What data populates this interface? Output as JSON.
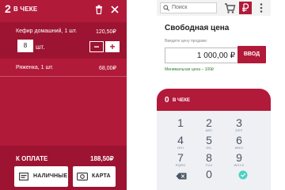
{
  "receipt": {
    "count": "2",
    "title": "В ЧЕКЕ",
    "items": [
      {
        "name": "Кефир домашний, 1 шт.",
        "price": "120,50₽",
        "qty": "8",
        "unit": "шт."
      },
      {
        "name": "Ряженка, 1 шт.",
        "price": "68,00₽"
      }
    ],
    "qty_minus": "−",
    "qty_plus": "+",
    "total_label": "К ОПЛАТЕ",
    "total_value": "188,50₽",
    "pay_cash": "НАЛИЧНЫЕ",
    "pay_card": "КАРТА"
  },
  "free_price": {
    "search_placeholder": "Поиск",
    "title": "Свободная цена",
    "input_label": "Введите цену продажи",
    "price_value": "1 000,00 ₽",
    "enter_button": "ВВОД",
    "min_price": "Минимальная цена – 100₽",
    "receipt_count": "0",
    "receipt_title": "В ЧЕКЕ",
    "keys": [
      {
        "d": "1",
        "s": ""
      },
      {
        "d": "2",
        "s": "ABC"
      },
      {
        "d": "3",
        "s": "DEF"
      },
      {
        "d": "4",
        "s": "GHI"
      },
      {
        "d": "5",
        "s": "JKL"
      },
      {
        "d": "6",
        "s": "MNO"
      },
      {
        "d": "7",
        "s": "PQRS"
      },
      {
        "d": "8",
        "s": "TUV"
      },
      {
        "d": "9",
        "s": "WXYZ"
      },
      {
        "d": "0",
        "s": ""
      }
    ]
  },
  "colors": {
    "accent": "#b21a3a",
    "accent_dark": "#9c1431",
    "green": "#2e7d32",
    "teal": "#4dd0c4"
  }
}
